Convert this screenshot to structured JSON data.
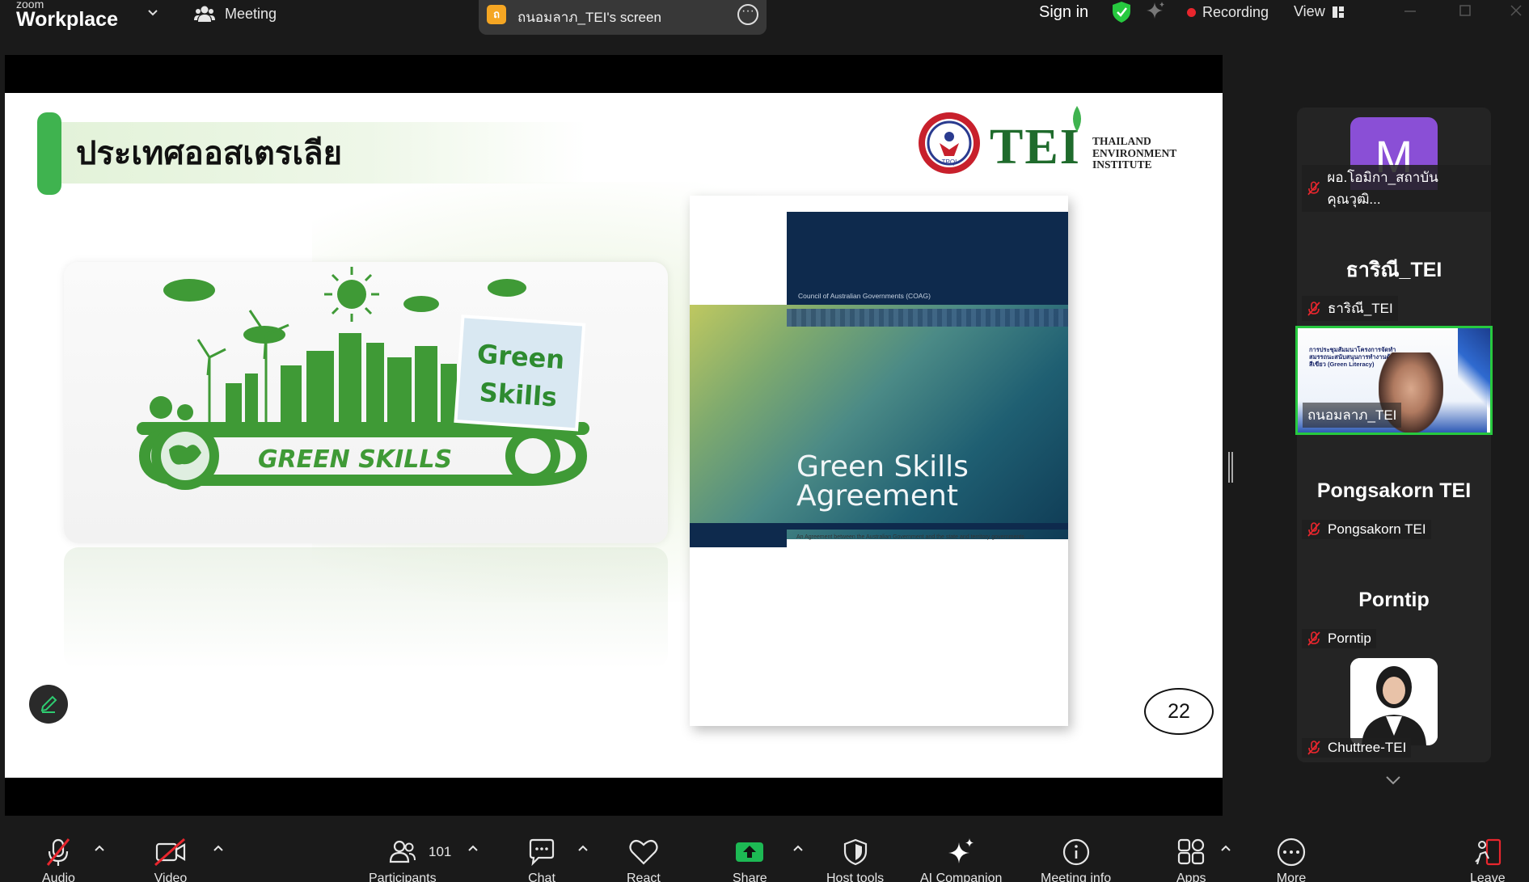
{
  "app": {
    "brand_small": "zoom",
    "brand_big": "Workplace",
    "meeting_label": "Meeting",
    "share_badge": "ถ",
    "share_title": "ถนอมลาภ_TEI's screen",
    "sign_in": "Sign in",
    "recording": "Recording",
    "view": "View",
    "colors": {
      "accent_green": "#27c93f",
      "record_red": "#e8262d",
      "share_green": "#1db954"
    }
  },
  "slide": {
    "title": "ประเทศออสเตรเลีย",
    "logo": {
      "mark_text": "TEI",
      "org_line1": "THAILAND",
      "org_line2": "ENVIRONMENT",
      "org_line3": "INSTITUTE",
      "seal_text": "TPQI"
    },
    "image": {
      "word1": "Green",
      "word2": "Skills",
      "gear_text": "GREEN SKILLS"
    },
    "report": {
      "publisher": "Council of Australian Governments (COAG)",
      "title_line1": "Green Skills",
      "title_line2": "Agreement",
      "subtitle": "An Agreement between the Australian Government and the state and territory governments"
    },
    "page_number": "22"
  },
  "participants": [
    {
      "kind": "avatar",
      "initial": "M",
      "name": "ผอ.โอมิกา_สถาบันคุณวุฒิ...",
      "muted": true
    },
    {
      "kind": "name",
      "big_name": "ธาริณี_TEI",
      "name": "ธาริณี_TEI",
      "muted": true
    },
    {
      "kind": "video",
      "name": "ถนอมลาภ_TEI",
      "slide_text": "การประชุมสัมมนาโครงการจัดทำสมรรถนะสนับสนุนการทำงานด้านทักษะสีเขียว (Green Literacy)",
      "active_speaker": true
    },
    {
      "kind": "name",
      "big_name": "Pongsakorn TEI",
      "name": "Pongsakorn TEI",
      "muted": true
    },
    {
      "kind": "name",
      "big_name": "Porntip",
      "name": "Porntip",
      "muted": true
    },
    {
      "kind": "photo",
      "name": "Chuttree-TEI",
      "muted": true
    }
  ],
  "toolbar": {
    "audio": "Audio",
    "video": "Video",
    "participants": "Participants",
    "participant_count": "101",
    "chat": "Chat",
    "react": "React",
    "share": "Share",
    "host_tools": "Host tools",
    "ai_companion": "AI Companion",
    "meeting_info": "Meeting info",
    "apps": "Apps",
    "more": "More",
    "leave": "Leave"
  }
}
